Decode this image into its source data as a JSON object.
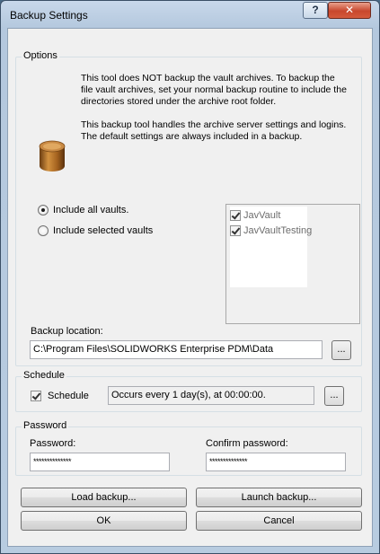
{
  "window": {
    "title": "Backup Settings",
    "help_label": "?",
    "close_label": "✕"
  },
  "options": {
    "legend": "Options",
    "description_lines": [
      "This tool does NOT backup the vault archives. To backup the",
      "file vault archives, set your normal backup routine to include the",
      "directories stored under the archive root folder."
    ],
    "note_lines": [
      "This backup tool handles the archive server settings and logins.",
      "The default settings are always included in a backup."
    ],
    "radio_all": "Include all vaults.",
    "radio_selected": "Include selected vaults",
    "selected_option": "all",
    "vaults": [
      {
        "name": "JavVault",
        "checked": true
      },
      {
        "name": "JavVaultTesting",
        "checked": true
      }
    ],
    "location_label": "Backup location:",
    "location_value": "C:\\Program Files\\SOLIDWORKS Enterprise PDM\\Data",
    "browse_label": "..."
  },
  "schedule": {
    "legend": "Schedule",
    "checkbox_label": "Schedule",
    "checked": true,
    "summary": "Occurs every 1 day(s), at 00:00:00.",
    "browse_label": "..."
  },
  "password": {
    "legend": "Password",
    "password_label": "Password:",
    "password_value": "**************",
    "confirm_label": "Confirm password:",
    "confirm_value": "**************"
  },
  "buttons": {
    "load": "Load backup...",
    "launch": "Launch backup...",
    "ok": "OK",
    "cancel": "Cancel"
  },
  "icon": "database-icon"
}
